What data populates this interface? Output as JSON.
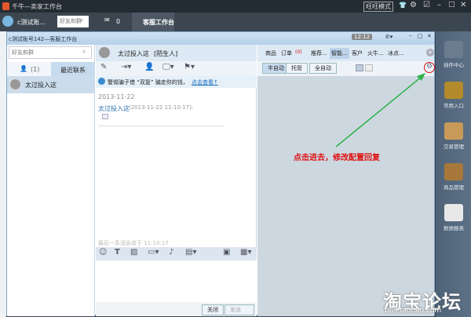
{
  "app": {
    "title": "千牛—卖家工作台",
    "mode": "旺旺模式"
  },
  "topbar": {
    "account": "c测试账...",
    "search_placeholder": "好友和群",
    "mail_count": "0",
    "workbench": "客服工作台"
  },
  "window": {
    "title": "c测试账号142—客服工作台",
    "time": "12:12"
  },
  "left": {
    "search_placeholder": "好友和群",
    "tab_count": "(1)",
    "tab_recent": "最近联系",
    "contacts": [
      {
        "name": "太过投入这"
      }
    ]
  },
  "chat": {
    "contact": "太过投入这",
    "tag": "[陌生人]",
    "notice": "警惕骗子借 “双复” 骗走你的钱，",
    "notice_link": "点击查看↑",
    "date": "2013-11-22",
    "msg_sender": "太过投入这",
    "msg_time": "(2013-11-22 11:10:17):",
    "last_msg": "最后一条消息收于 11:10:17",
    "close_btn": "关闭",
    "send_btn": "发送"
  },
  "right": {
    "tabs": [
      "商品",
      "订单",
      "推荐...",
      "智能...",
      "客户",
      "火牛...",
      "冰点..."
    ],
    "order_badge": "(0)",
    "modes": [
      "半自动",
      "托管",
      "全自动"
    ],
    "annotation": "点击进去，修改配置回复",
    "annotation_color": "#d11",
    "arrow_color": "#2db24a"
  },
  "sidebar": {
    "items": [
      "插件中心",
      "常用入口",
      "交易管理",
      "商品管理",
      "数据报表"
    ]
  },
  "watermark": {
    "main": "淘宝论坛",
    "url": "bbs.taobao.com"
  }
}
